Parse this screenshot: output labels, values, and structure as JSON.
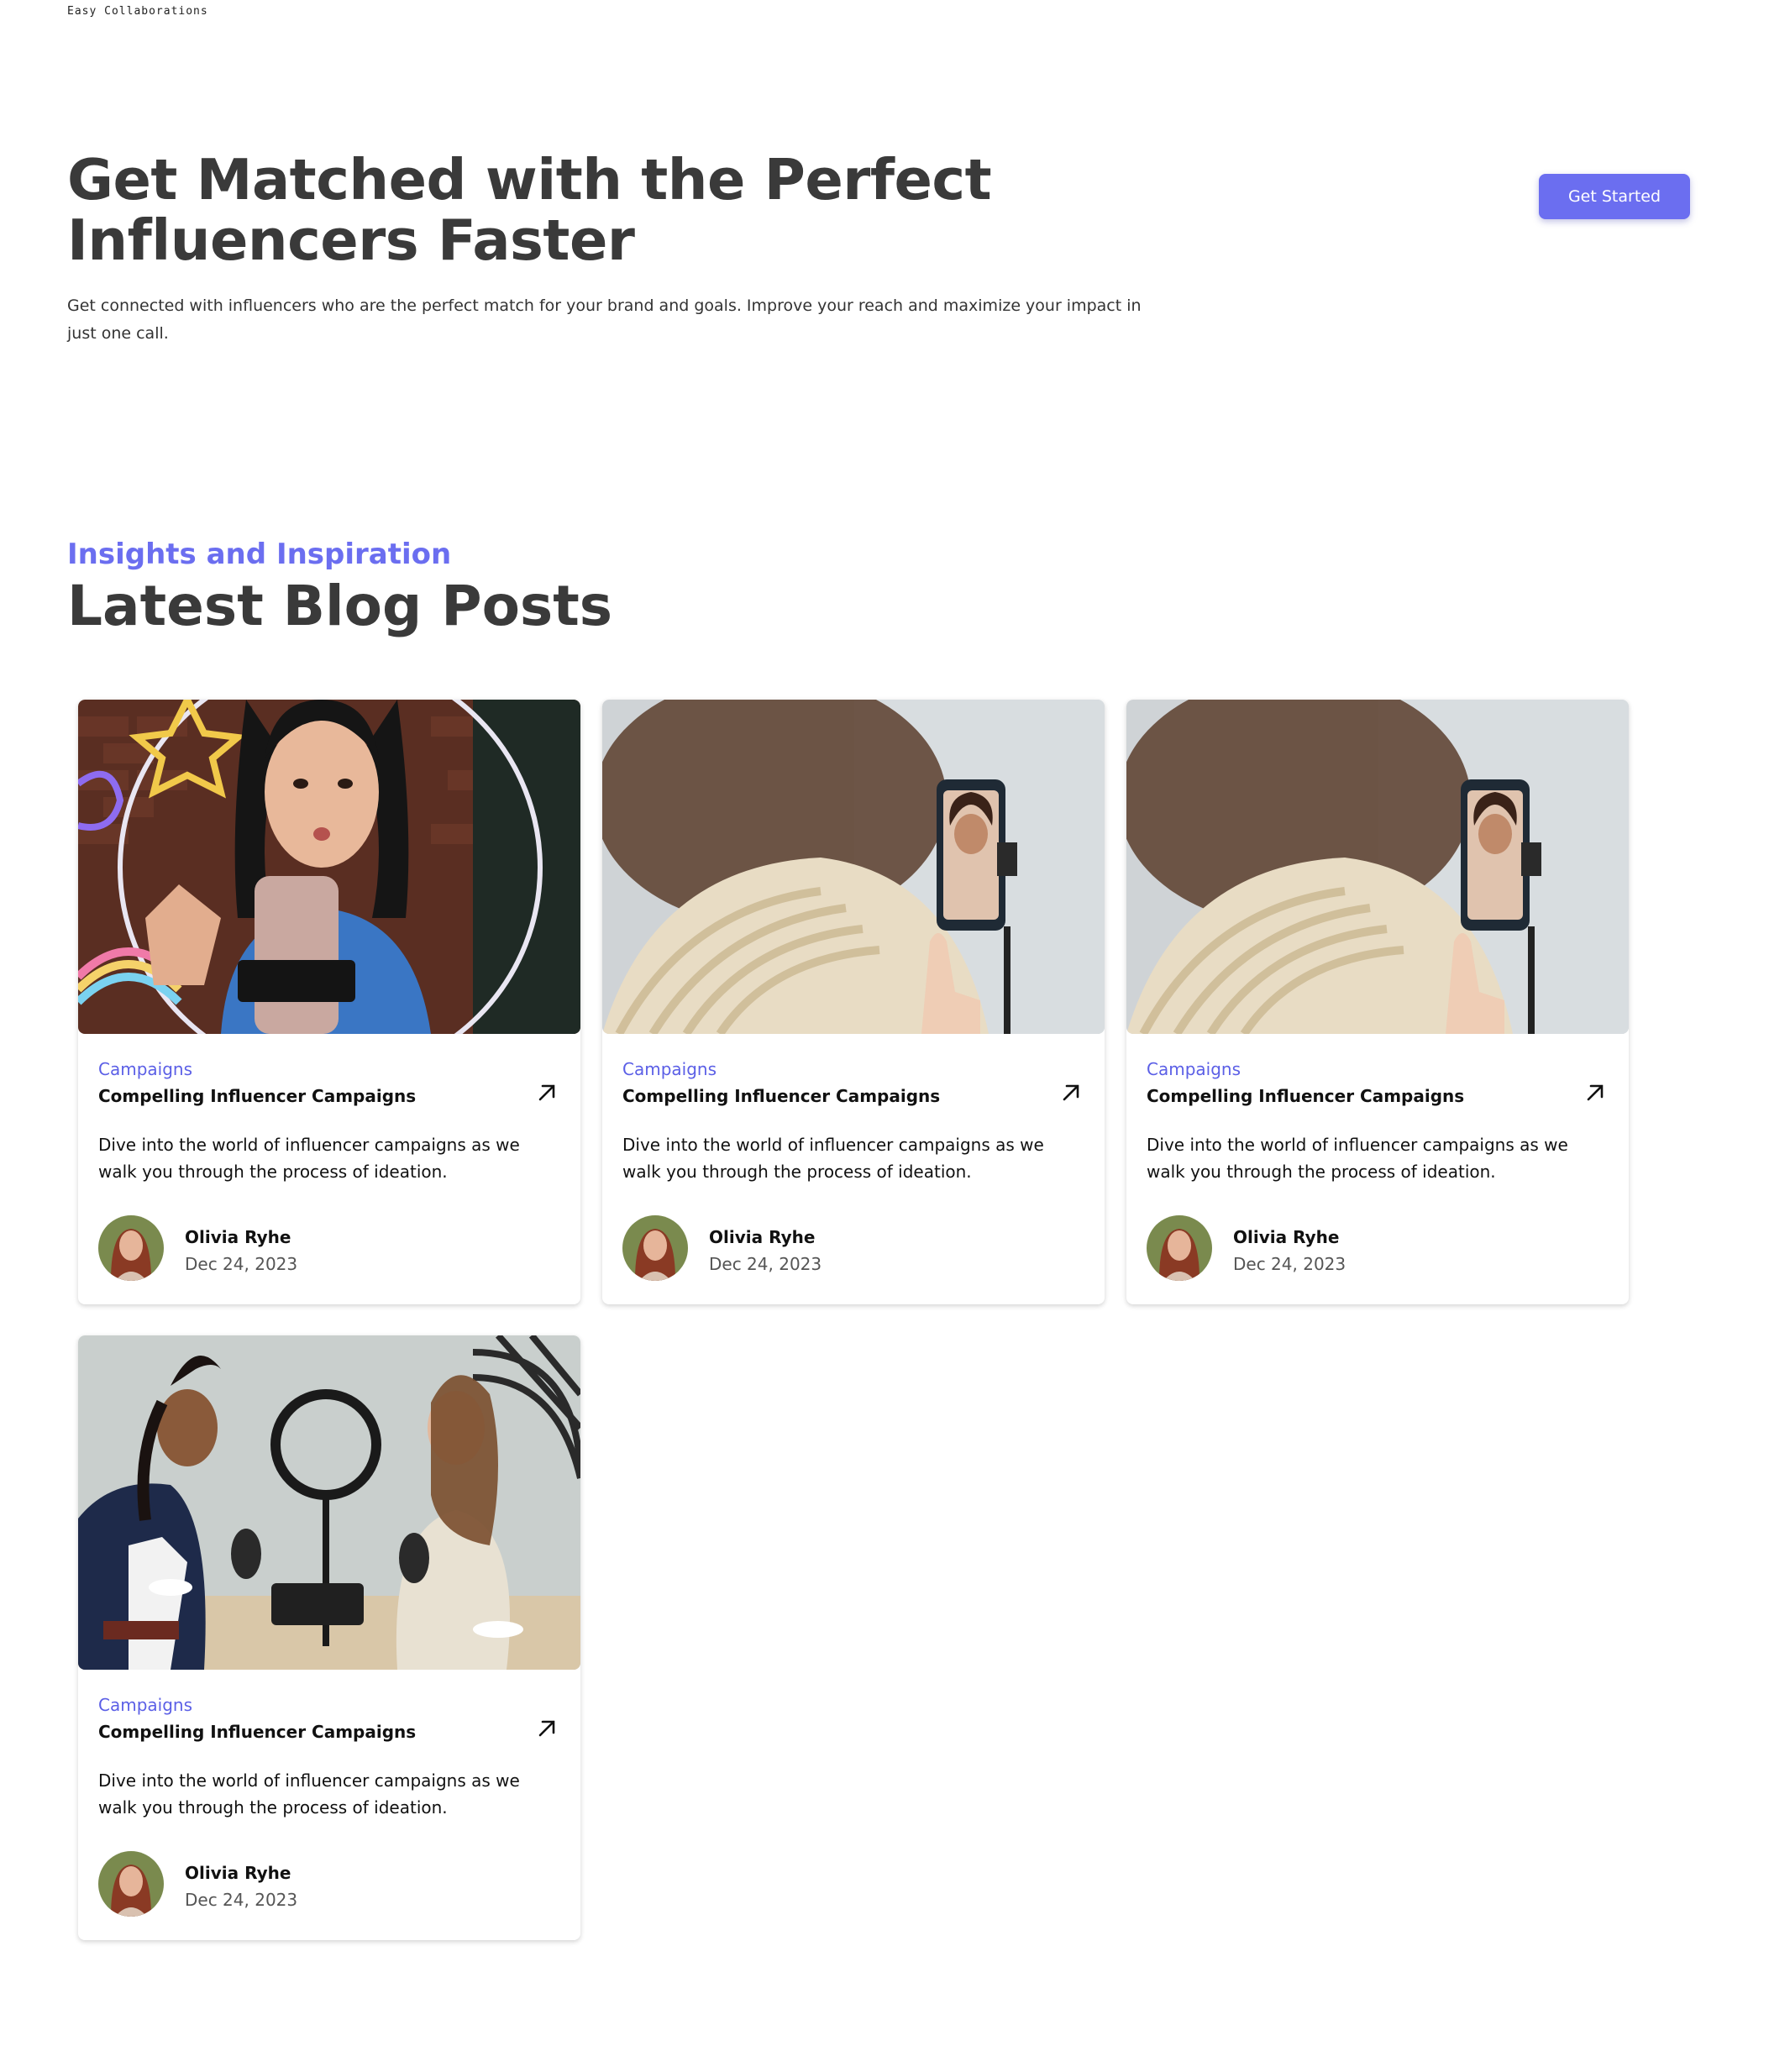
{
  "brand": {
    "tagline": "Easy Collaborations"
  },
  "hero": {
    "title": "Get Matched with the Perfect Influencers Faster",
    "description": "Get connected with influencers who are the perfect match for your brand and goals. Improve your reach and maximize your impact in just one call.",
    "cta_label": "Get Started"
  },
  "blog": {
    "eyebrow": "Insights and Inspiration",
    "title": "Latest Blog Posts",
    "posts": [
      {
        "category": "Campaigns",
        "title": "Compelling Influencer Campaigns",
        "description": "Dive into the world of influencer campaigns as we walk you through the process of ideation.",
        "author": "Olivia Ryhe",
        "date": "Dec 24, 2023"
      },
      {
        "category": "Campaigns",
        "title": "Compelling Influencer Campaigns",
        "description": "Dive into the world of influencer campaigns as we walk you through the process of ideation.",
        "author": "Olivia Ryhe",
        "date": "Dec 24, 2023"
      },
      {
        "category": "Campaigns",
        "title": "Compelling Influencer Campaigns",
        "description": "Dive into the world of influencer campaigns as we walk you through the process of ideation.",
        "author": "Olivia Ryhe",
        "date": "Dec 24, 2023"
      },
      {
        "category": "Campaigns",
        "title": "Compelling Influencer Campaigns",
        "description": "Dive into the world of influencer campaigns as we walk you through the process of ideation.",
        "author": "Olivia Ryhe",
        "date": "Dec 24, 2023"
      }
    ]
  },
  "icons": {
    "card_link": "arrow-up-right-icon"
  },
  "colors": {
    "accent": "#6b6ef0",
    "heading": "#3a3a3a"
  }
}
